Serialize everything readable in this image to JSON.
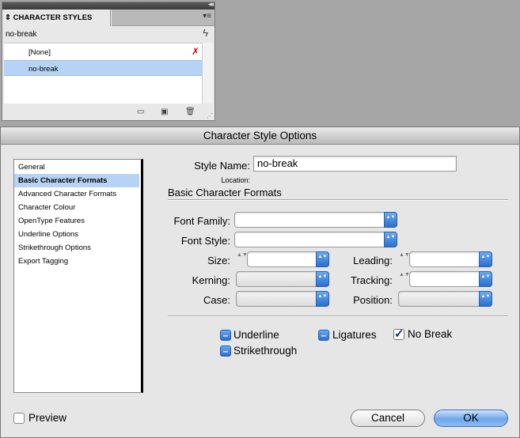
{
  "panel": {
    "collapse_glyph": "◂◂",
    "tab_label": "CHARACTER STYLES",
    "tab_glyph": "⇕",
    "menu_glyph": "▾≡",
    "current_style": "no-break",
    "bolt_glyph": "ϟ",
    "items": [
      "[None]",
      "no-break"
    ],
    "selected_item": "no-break",
    "none_icon_glyph": "✗",
    "buttons": {
      "folder": "▭",
      "new": "▣",
      "trash": "🗑"
    },
    "grip_glyph": "⋰"
  },
  "dialog": {
    "title": "Character Style Options",
    "nav": [
      "General",
      "Basic Character Formats",
      "Advanced Character Formats",
      "Character Colour",
      "OpenType Features",
      "Underline Options",
      "Strikethrough Options",
      "Export Tagging"
    ],
    "nav_selected": "Basic Character Formats",
    "style_name_label": "Style Name:",
    "style_name_value": "no-break",
    "location_label": "Location:",
    "section_title": "Basic Character Formats",
    "font_family_label": "Font Family:",
    "font_style_label": "Font Style:",
    "size_label": "Size:",
    "leading_label": "Leading:",
    "kerning_label": "Kerning:",
    "tracking_label": "Tracking:",
    "case_label": "Case:",
    "position_label": "Position:",
    "combo_arrow_glyph": "▲▼",
    "stepper_glyph": "▲▼",
    "mixed_glyph": "–",
    "check_glyph": "✓",
    "underline_label": "Underline",
    "ligatures_label": "Ligatures",
    "nobreak_label": "No Break",
    "strikethrough_label": "Strikethrough",
    "preview_label": "Preview",
    "cancel_label": "Cancel",
    "ok_label": "OK"
  },
  "colors": {
    "selection": "#b6d3f5",
    "accent_blue": "#2a6fd0",
    "chrome_gray": "#a6a6a6"
  }
}
